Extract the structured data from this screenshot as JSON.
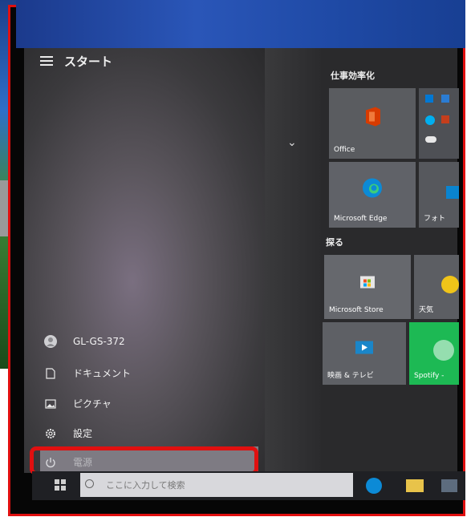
{
  "start_menu": {
    "title": "スタート",
    "user_name": "GL-GS-372",
    "items": [
      {
        "label": "ドキュメント",
        "icon": "document-icon"
      },
      {
        "label": "ピクチャ",
        "icon": "picture-icon"
      },
      {
        "label": "設定",
        "icon": "gear-icon"
      },
      {
        "label": "電源",
        "icon": "power-icon"
      }
    ]
  },
  "groups": {
    "productivity": "仕事効率化",
    "explore": "探る"
  },
  "tiles": {
    "office": "Office",
    "edge": "Microsoft Edge",
    "photos": "フォト",
    "store": "Microsoft Store",
    "weather": "天気",
    "movies": "映画 & テレビ",
    "spotify": "Spotify - "
  },
  "taskbar": {
    "search_placeholder": "ここに入力して検索"
  },
  "colors": {
    "highlight_border": "#e01010",
    "spotify_green": "#1db954",
    "office_red": "#d83b01",
    "edge_blue": "#0c8ad6"
  }
}
